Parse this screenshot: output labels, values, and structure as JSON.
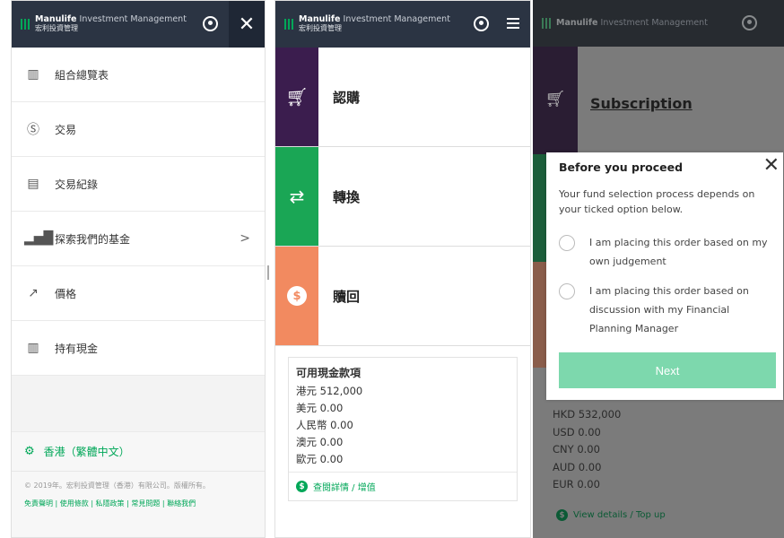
{
  "brand": {
    "name_bold": "Manulife",
    "name_light": "Investment Management",
    "sub": "宏利投資管理"
  },
  "panel1": {
    "menu": [
      {
        "label": "組合總覽表",
        "icon": "book-icon"
      },
      {
        "label": "交易",
        "icon": "dollar-circle-icon"
      },
      {
        "label": "交易紀錄",
        "icon": "record-icon"
      },
      {
        "label": "探索我們的基金",
        "icon": "bar-chart-icon",
        "chevron": ">"
      },
      {
        "label": "價格",
        "icon": "trend-icon"
      },
      {
        "label": "持有現金",
        "icon": "book-icon"
      }
    ],
    "language": "香港（繁體中文）",
    "copyright": "© 2019年。宏利投資管理（香港）有限公司。版權所有。",
    "links": "免責聲明 | 使用條款 | 私隱政策 | 常見問題 | 聯絡我們",
    "close": "✕"
  },
  "panel2": {
    "tiles": [
      {
        "label": "認購",
        "color": "#3b1d4e"
      },
      {
        "label": "轉換",
        "color": "#1aa655"
      },
      {
        "label": "贖回",
        "color": "#f28a60"
      }
    ],
    "cash_title": "可用現金款項",
    "cash_lines": [
      "港元 512,000",
      "美元 0.00",
      "人民幣 0.00",
      "澳元 0.00",
      "歐元 0.00"
    ],
    "link": "查閱詳情 / 增值"
  },
  "panel3": {
    "title": "Subscription",
    "cash_lines": [
      "HKD 532,000",
      "USD 0.00",
      "CNY 0.00",
      "AUD 0.00",
      "EUR 0.00"
    ],
    "link": "View details / Top up",
    "modal": {
      "title": "Before you proceed",
      "close": "✕",
      "desc": "Your fund selection process depends on your ticked option below.",
      "option1": "I am placing this order based on my own judgement",
      "option2": "I am placing this order based on discussion with my Financial Planning Manager",
      "button": "Next"
    }
  }
}
